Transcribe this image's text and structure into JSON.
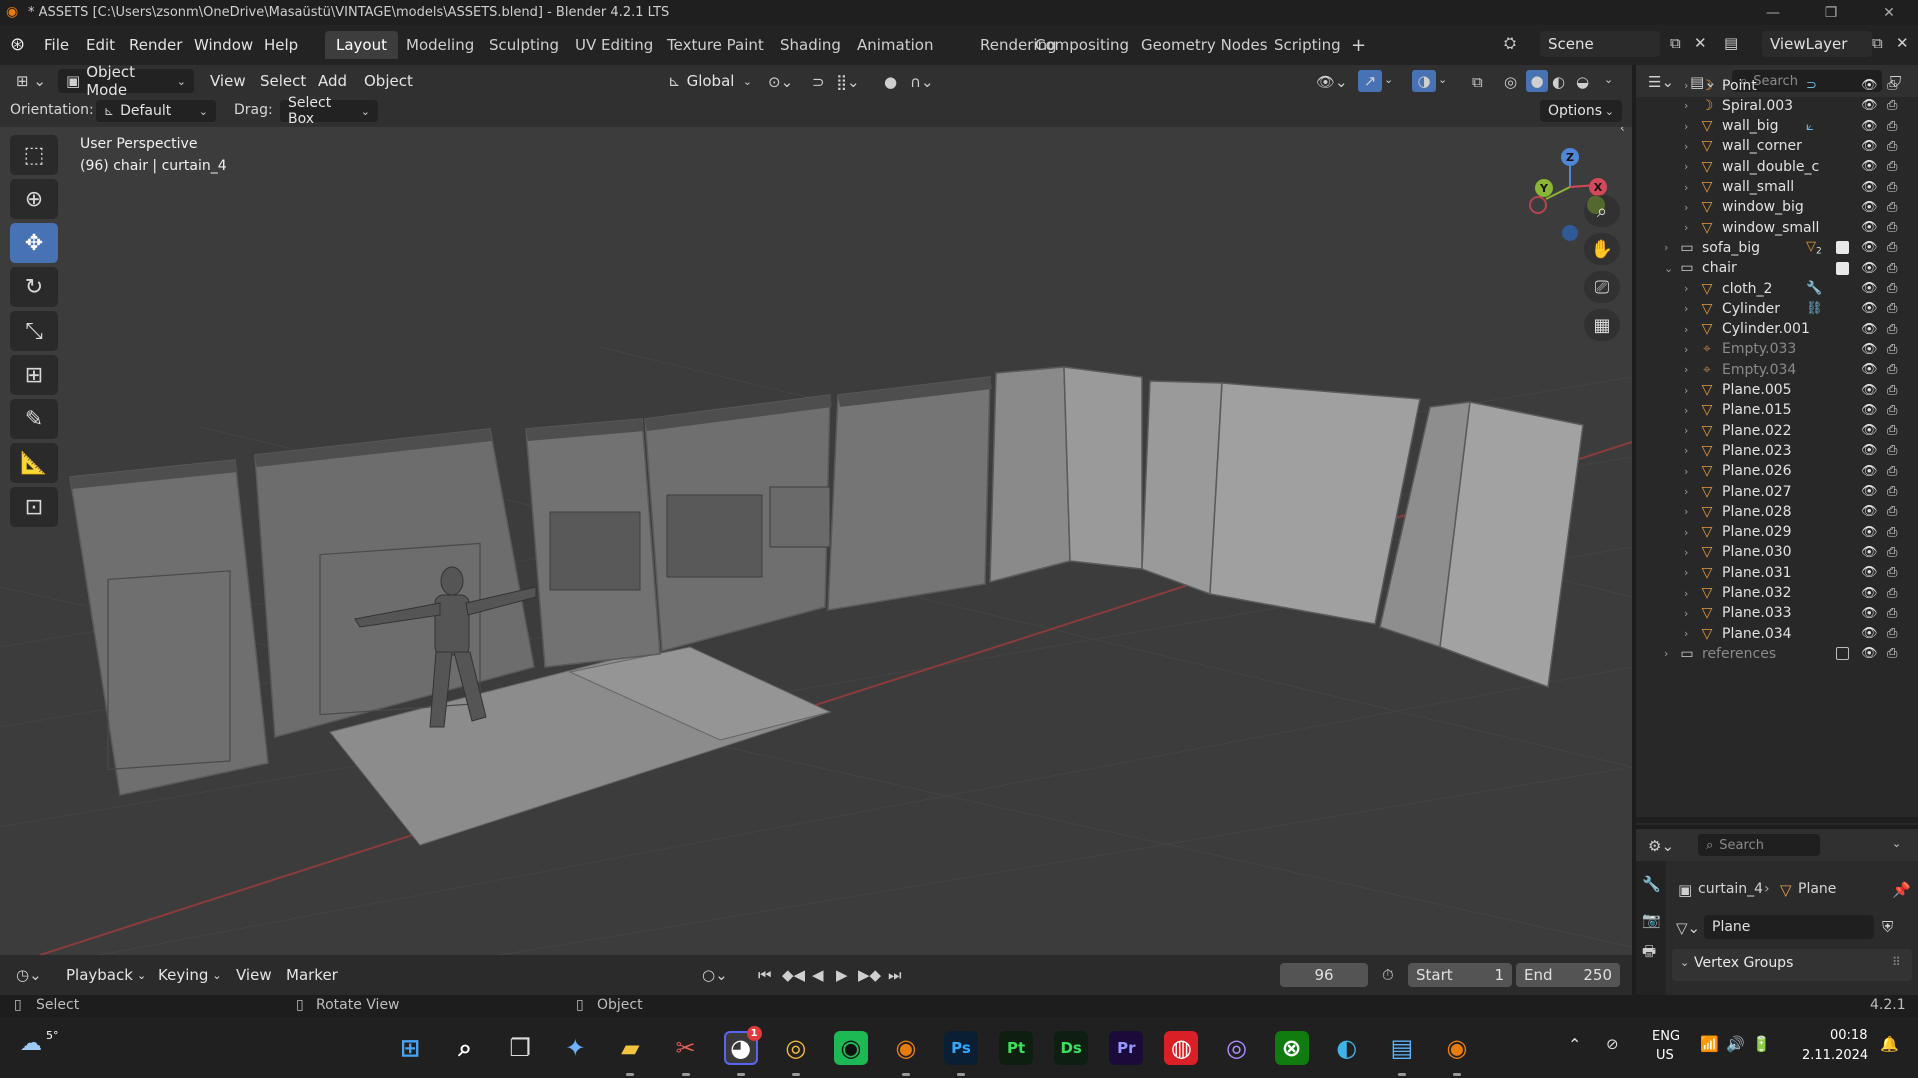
{
  "window": {
    "title": "* ASSETS [C:\\Users\\zsonm\\OneDrive\\Masaüstü\\VINTAGE\\models\\ASSETS.blend] - Blender 4.2.1 LTS"
  },
  "menu": {
    "items": [
      "File",
      "Edit",
      "Render",
      "Window",
      "Help"
    ]
  },
  "workspaces": {
    "tabs": [
      "Layout",
      "Modeling",
      "Sculpting",
      "UV Editing",
      "Texture Paint",
      "Shading",
      "Animation",
      "Rendering",
      "Compositing",
      "Geometry Nodes",
      "Scripting"
    ],
    "add_label": "+"
  },
  "scene": {
    "label": "Scene"
  },
  "viewlayer": {
    "label": "ViewLayer"
  },
  "viewport_header": {
    "mode": "Object Mode",
    "menus": [
      "View",
      "Select",
      "Add",
      "Object"
    ],
    "transform_orientation": "Global"
  },
  "tool_settings": {
    "orientation_label": "Orientation:",
    "orientation_value": "Default",
    "drag_label": "Drag:",
    "drag_value": "Select Box",
    "options_label": "Options"
  },
  "viewport": {
    "overlay_line1": "User Perspective",
    "overlay_line2": "(96) chair | curtain_4",
    "gizmo_axes": [
      "Z",
      "Y",
      "X"
    ]
  },
  "outliner": {
    "search_placeholder": "Search",
    "rows": [
      {
        "name": "Point",
        "kind": "light",
        "indent": 1,
        "extra": "light-data-icon"
      },
      {
        "name": "Spiral.003",
        "kind": "curve",
        "indent": 1
      },
      {
        "name": "wall_big",
        "kind": "mesh",
        "indent": 1,
        "extra": "modifier-icon"
      },
      {
        "name": "wall_corner",
        "kind": "mesh",
        "indent": 1
      },
      {
        "name": "wall_double_c",
        "kind": "mesh",
        "indent": 1
      },
      {
        "name": "wall_small",
        "kind": "mesh",
        "indent": 1
      },
      {
        "name": "window_big",
        "kind": "mesh",
        "indent": 1
      },
      {
        "name": "window_small",
        "kind": "mesh",
        "indent": 1
      },
      {
        "name": "sofa_big",
        "kind": "collection",
        "indent": 0,
        "check": true,
        "badge": "2"
      },
      {
        "name": "chair",
        "kind": "collection",
        "indent": 0,
        "check": true,
        "expanded": true
      },
      {
        "name": "cloth_2",
        "kind": "mesh",
        "indent": 1,
        "extra": "wrench-icon"
      },
      {
        "name": "Cylinder",
        "kind": "mesh",
        "indent": 1,
        "extra": "constraint-icon"
      },
      {
        "name": "Cylinder.001",
        "kind": "mesh",
        "indent": 1
      },
      {
        "name": "Empty.033",
        "kind": "empty",
        "indent": 1,
        "dim": true
      },
      {
        "name": "Empty.034",
        "kind": "empty",
        "indent": 1,
        "dim": true
      },
      {
        "name": "Plane.005",
        "kind": "mesh",
        "indent": 1
      },
      {
        "name": "Plane.015",
        "kind": "mesh",
        "indent": 1
      },
      {
        "name": "Plane.022",
        "kind": "mesh",
        "indent": 1
      },
      {
        "name": "Plane.023",
        "kind": "mesh",
        "indent": 1
      },
      {
        "name": "Plane.026",
        "kind": "mesh",
        "indent": 1
      },
      {
        "name": "Plane.027",
        "kind": "mesh",
        "indent": 1
      },
      {
        "name": "Plane.028",
        "kind": "mesh",
        "indent": 1
      },
      {
        "name": "Plane.029",
        "kind": "mesh",
        "indent": 1
      },
      {
        "name": "Plane.030",
        "kind": "mesh",
        "indent": 1
      },
      {
        "name": "Plane.031",
        "kind": "mesh",
        "indent": 1
      },
      {
        "name": "Plane.032",
        "kind": "mesh",
        "indent": 1
      },
      {
        "name": "Plane.033",
        "kind": "mesh",
        "indent": 1
      },
      {
        "name": "Plane.034",
        "kind": "mesh",
        "indent": 1
      },
      {
        "name": "references",
        "kind": "collection",
        "indent": 0,
        "check": false,
        "dim": true
      }
    ]
  },
  "properties": {
    "search_placeholder": "Search",
    "breadcrumb_object": "curtain_4",
    "breadcrumb_data": "Plane",
    "data_name": "Plane",
    "panel_title": "Vertex Groups"
  },
  "timeline": {
    "menus": [
      "Playback",
      "Keying",
      "View",
      "Marker"
    ],
    "current_frame": "96",
    "start_label": "Start",
    "start_value": "1",
    "end_label": "End",
    "end_value": "250"
  },
  "statusbar": {
    "select": "Select",
    "rotate": "Rotate View",
    "object": "Object",
    "version": "4.2.1"
  },
  "taskbar": {
    "weather": "5°",
    "apps": [
      "start",
      "search",
      "taskview",
      "copilot",
      "explorer",
      "snipping",
      "discord",
      "chrome",
      "spotify",
      "blender",
      "Ps",
      "Pt",
      "Ds",
      "Pr",
      "cc",
      "media",
      "xbox",
      "edge",
      "notepad",
      "blender2"
    ],
    "discord_badge": "1",
    "lang_line1": "ENG",
    "lang_line2": "US",
    "time": "00:18",
    "date": "2.11.2024"
  }
}
